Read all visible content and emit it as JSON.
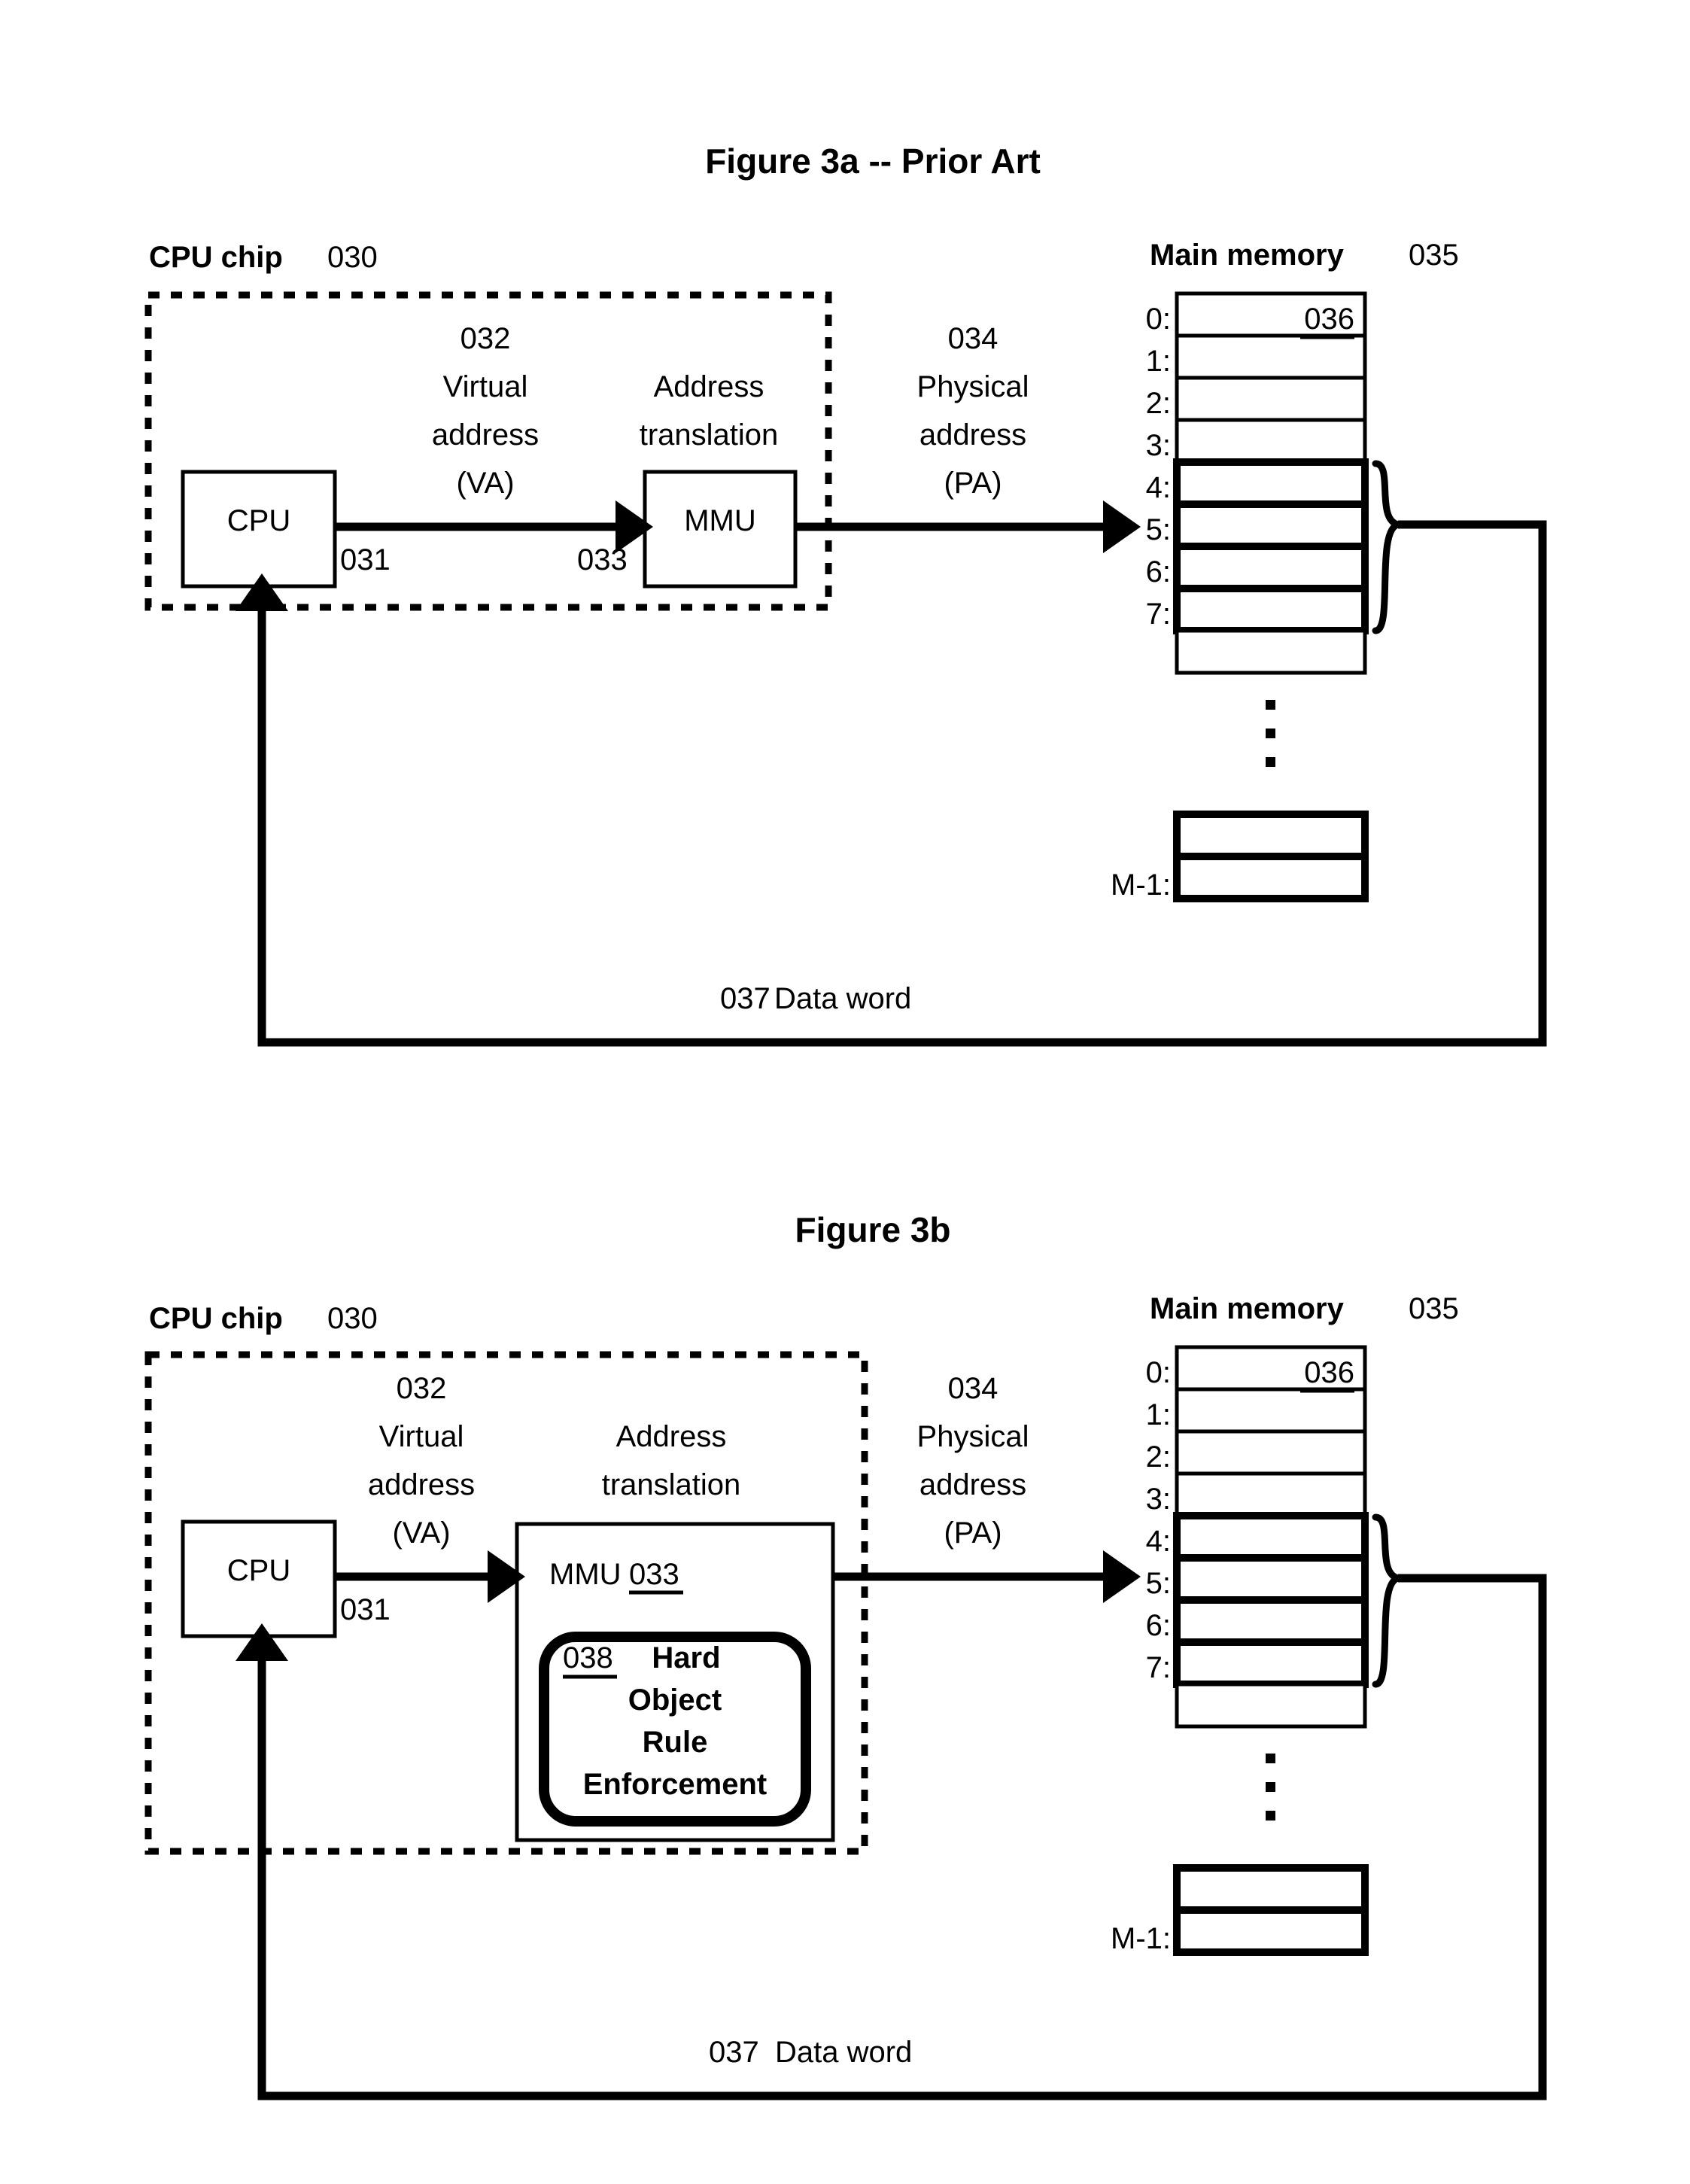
{
  "figures": [
    {
      "id": "fig3a",
      "title": "Figure 3a -- Prior Art",
      "chip": {
        "label_bold": "CPU chip",
        "label_ref": "030"
      },
      "memory": {
        "label_bold": "Main memory",
        "label_ref": "035"
      },
      "cpu_box_label": "CPU",
      "mmu_box_label": "MMU",
      "cpu_out_ref": "031",
      "mmu_in_ref": "033",
      "va_label": {
        "ref": "032",
        "line1": "Virtual",
        "line2": "address",
        "line3": "(VA)"
      },
      "translation_label": {
        "line1": "Address",
        "line2": "translation"
      },
      "pa_label": {
        "ref": "034",
        "line1": "Physical",
        "line2": "address",
        "line3": "(PA)"
      },
      "cell_ref": "036",
      "data_word": {
        "ref": "037",
        "text": "Data word"
      },
      "row_labels": [
        "0:",
        "1:",
        "2:",
        "3:",
        "4:",
        "5:",
        "6:",
        "7:"
      ],
      "last_row_label": "M-1:",
      "vdots": "⋮"
    },
    {
      "id": "fig3b",
      "title": "Figure 3b",
      "chip": {
        "label_bold": "CPU chip",
        "label_ref": "030"
      },
      "memory": {
        "label_bold": "Main memory",
        "label_ref": "035"
      },
      "cpu_box_label": "CPU",
      "mmu_box_label": "MMU",
      "mmu_box_ref": "033",
      "cpu_out_ref": "031",
      "va_label": {
        "ref": "032",
        "line1": "Virtual",
        "line2": "address",
        "line3": "(VA)"
      },
      "translation_label": {
        "line1": "Address",
        "line2": "translation"
      },
      "pa_label": {
        "ref": "034",
        "line1": "Physical",
        "line2": "address",
        "line3": "(PA)"
      },
      "hard_object": {
        "ref": "038",
        "line1": "Hard",
        "line2": "Object",
        "line3": "Rule",
        "line4": "Enforcement"
      },
      "cell_ref": "036",
      "data_word": {
        "ref": "037",
        "text": "Data word"
      },
      "row_labels": [
        "0:",
        "1:",
        "2:",
        "3:",
        "4:",
        "5:",
        "6:",
        "7:"
      ],
      "last_row_label": "M-1:",
      "vdots": "⋮"
    }
  ],
  "colors": {
    "ink": "#000000",
    "paper": "#ffffff"
  }
}
